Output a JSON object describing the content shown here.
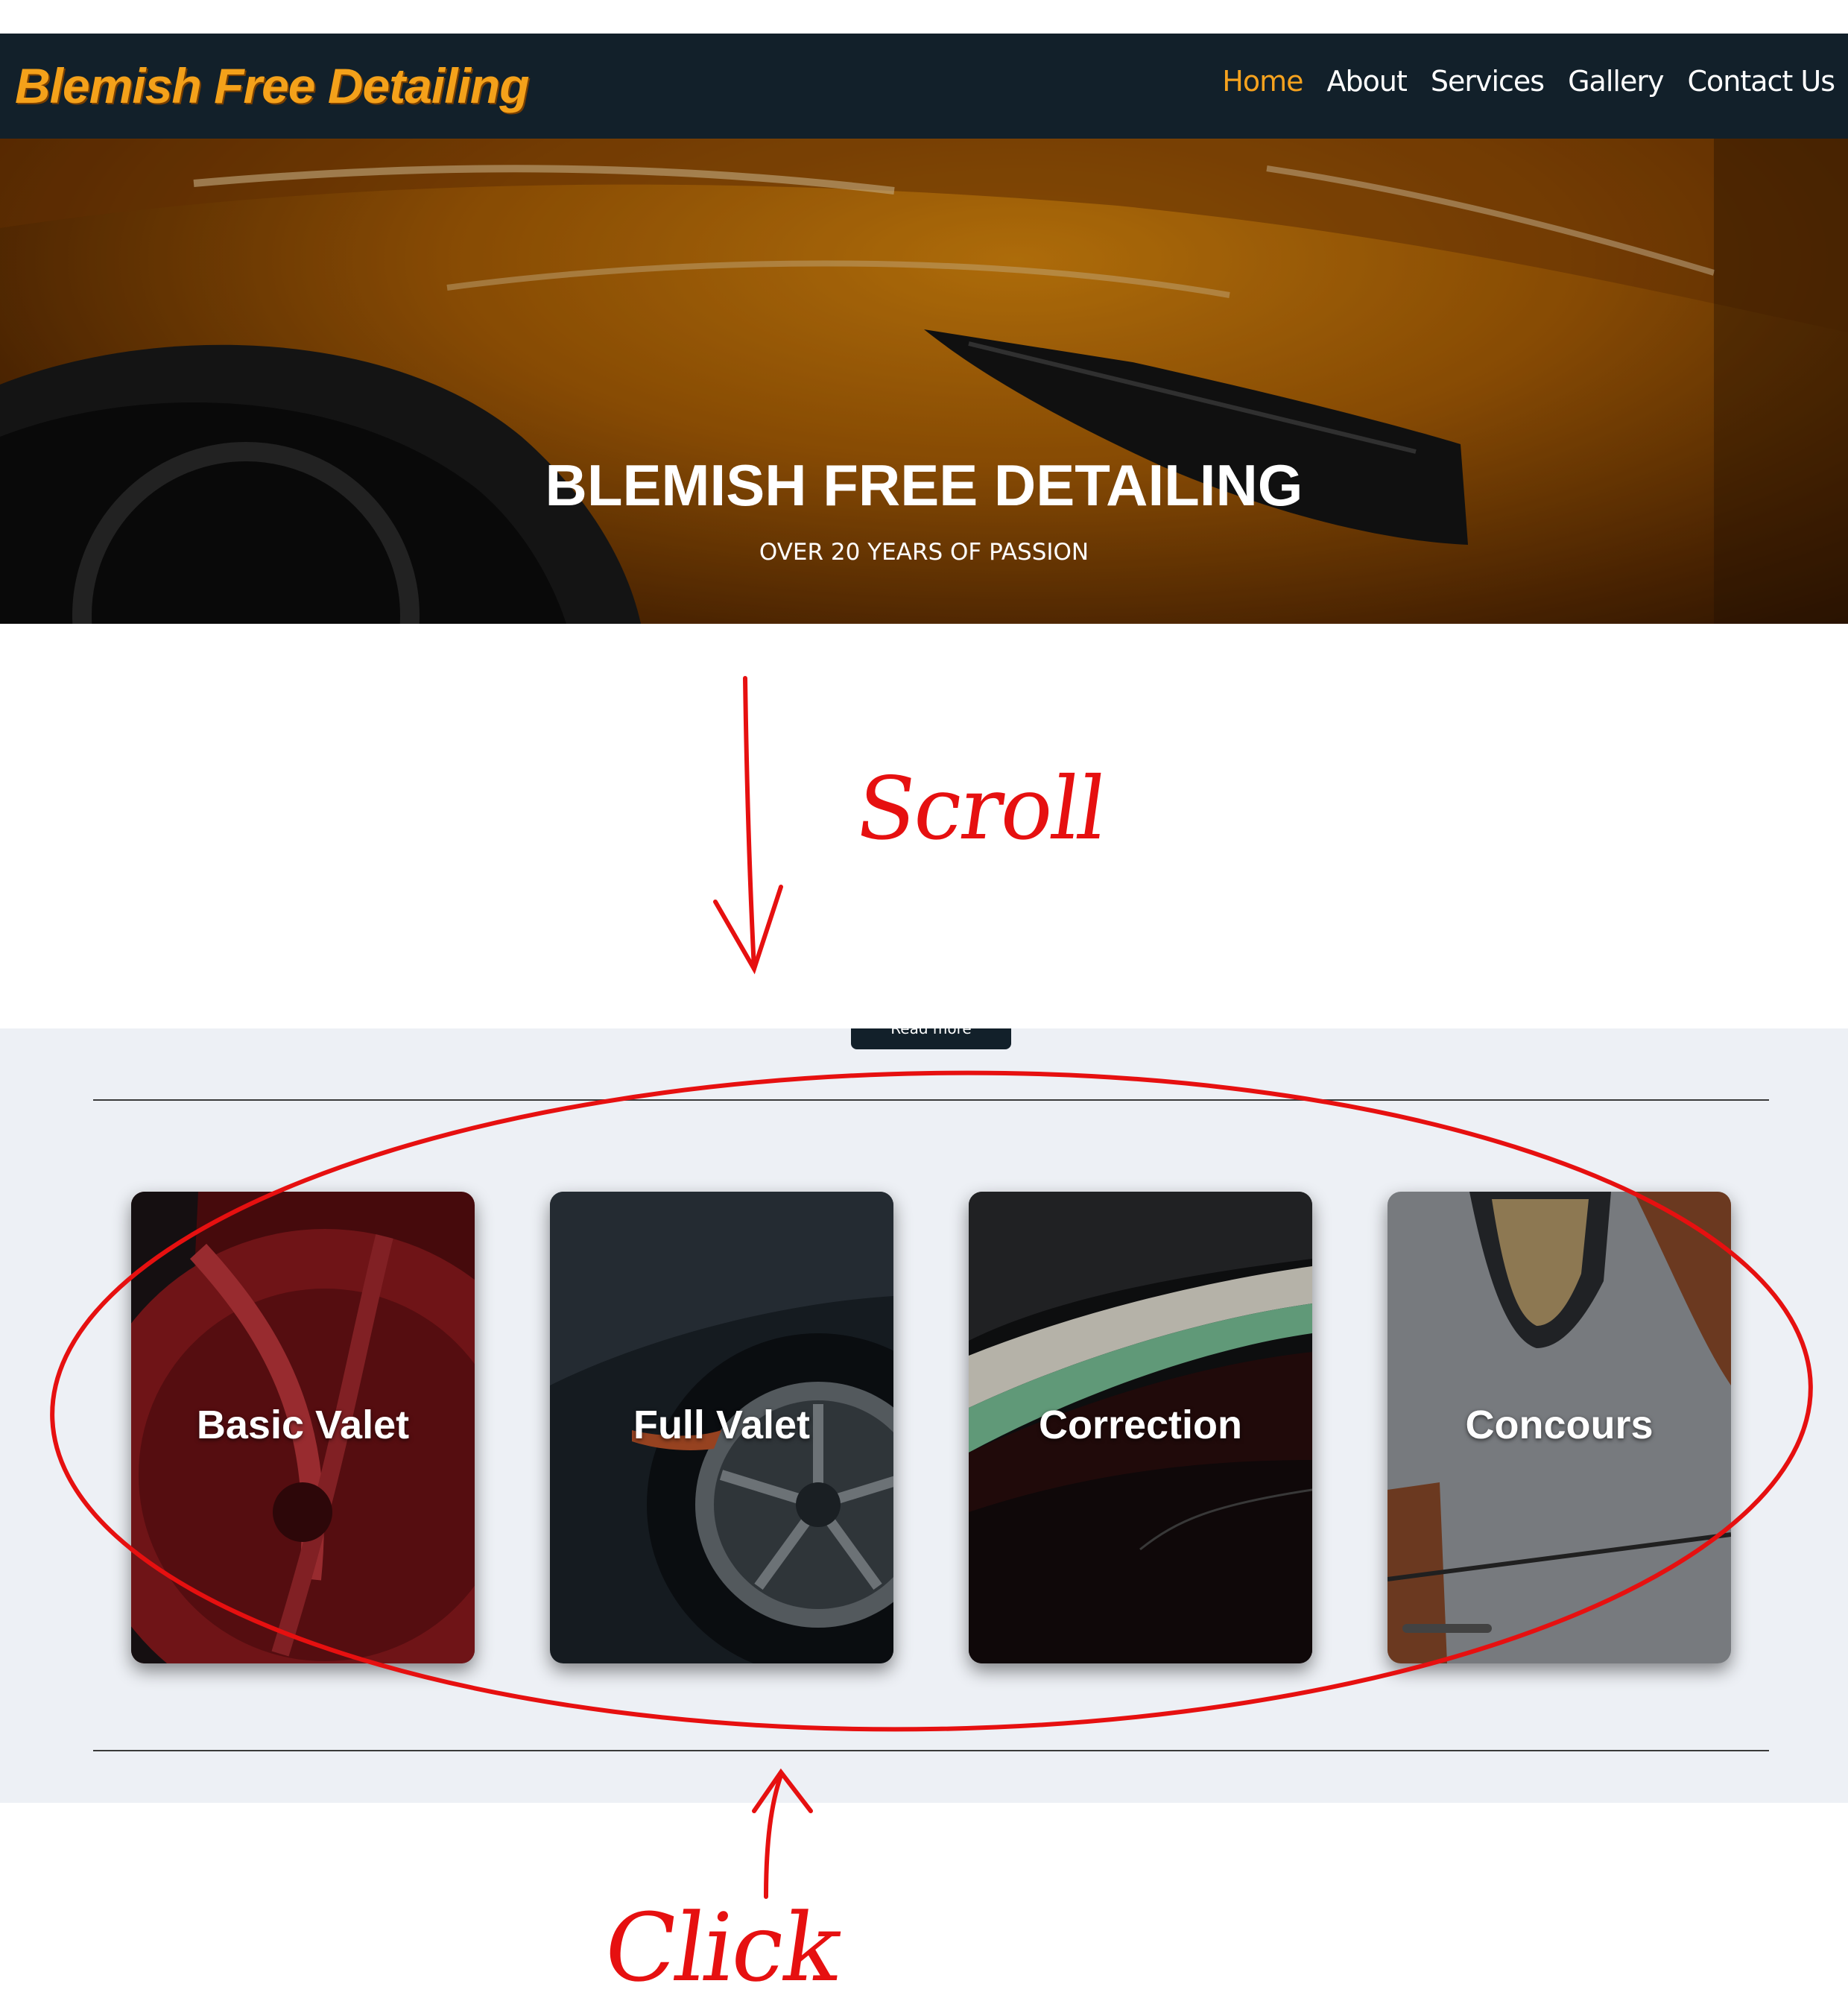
{
  "header": {
    "brand": "Blemish Free Detailing",
    "nav": [
      "Home",
      "About",
      "Services",
      "Gallery",
      "Contact Us"
    ],
    "active": "Home"
  },
  "hero": {
    "title": "BLEMISH FREE DETAILING",
    "subtitle": "OVER 20 YEARS OF PASSION"
  },
  "services": {
    "read_more": "Read more",
    "cards": [
      "Basic Valet",
      "Full Valet",
      "Correction",
      "Concours"
    ]
  },
  "annotations": {
    "scroll": "Scroll",
    "click": "Click",
    "color": "#e61010"
  },
  "colors": {
    "navbar": "#12202a",
    "brand": "#f4a11a",
    "nav_active": "#f6a21e",
    "services_bg": "#edf0f5"
  }
}
